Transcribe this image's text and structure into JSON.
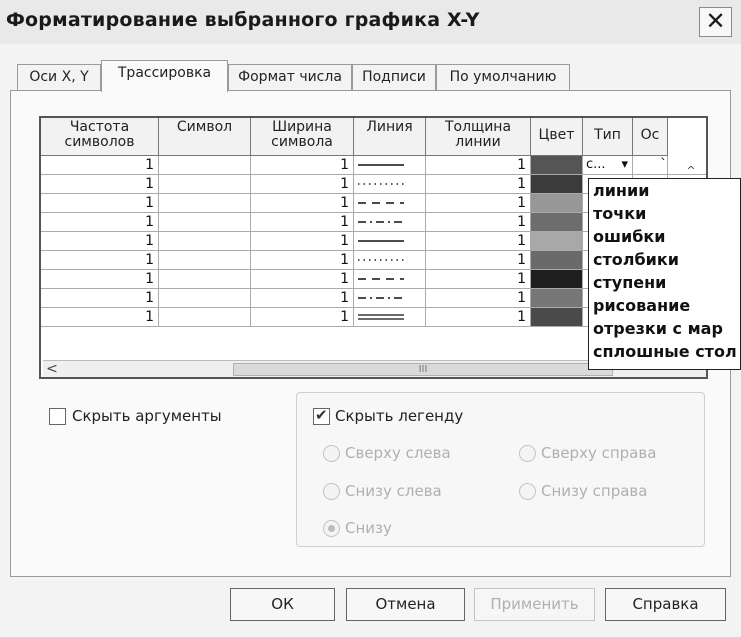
{
  "window": {
    "title": "Форматирование выбранного графика X-Y",
    "close_label": "✕"
  },
  "tabs": [
    "Оси X, Y",
    "Трассировка",
    "Формат числа",
    "Подписи",
    "По умолчанию"
  ],
  "grid": {
    "headers": [
      "Частота символов",
      "Символ",
      "Ширина символа",
      "Линия",
      "Толщина линии",
      "Цвет",
      "Тип",
      "Ос"
    ],
    "rows": [
      {
        "freq": "1",
        "width": "1",
        "line": "solid",
        "thickness": "1",
        "color": "#555555",
        "type": "с...",
        "type_arrow": "▾",
        "axis": "`"
      },
      {
        "freq": "1",
        "width": "1",
        "line": "dotted",
        "thickness": "1",
        "color": "#3b3b3b",
        "type": "",
        "type_arrow": "",
        "axis": ""
      },
      {
        "freq": "1",
        "width": "1",
        "line": "dashed",
        "thickness": "1",
        "color": "#979797",
        "type": "",
        "type_arrow": "",
        "axis": ""
      },
      {
        "freq": "1",
        "width": "1",
        "line": "dashdot",
        "thickness": "1",
        "color": "#6d6d6d",
        "type": "",
        "type_arrow": "",
        "axis": ""
      },
      {
        "freq": "1",
        "width": "1",
        "line": "solid",
        "thickness": "1",
        "color": "#a8a8a8",
        "type": "",
        "type_arrow": "",
        "axis": ""
      },
      {
        "freq": "1",
        "width": "1",
        "line": "dotted",
        "thickness": "1",
        "color": "#6a6a6a",
        "type": "",
        "type_arrow": "",
        "axis": ""
      },
      {
        "freq": "1",
        "width": "1",
        "line": "dashed",
        "thickness": "1",
        "color": "#1e1e1e",
        "type": "",
        "type_arrow": "",
        "axis": ""
      },
      {
        "freq": "1",
        "width": "1",
        "line": "dashdot",
        "thickness": "1",
        "color": "#777777",
        "type": "",
        "type_arrow": "",
        "axis": ""
      },
      {
        "freq": "1",
        "width": "1",
        "line": "double",
        "thickness": "1",
        "color": "#4a4a4a",
        "type": "",
        "type_arrow": "",
        "axis": ""
      }
    ],
    "hscroll_thumb_label": "III",
    "scroll_left": "<",
    "scroll_up": "^"
  },
  "type_dropdown": {
    "options": [
      "линии",
      "точки",
      "ошибки",
      "столбики",
      "ступени",
      "рисование",
      "отрезки с мар",
      "сплошные стол"
    ]
  },
  "hide_arguments": {
    "label": "Скрыть аргументы",
    "checked": false
  },
  "hide_legend": {
    "label": "Скрыть легенду",
    "checked": true,
    "check_mark": "✔"
  },
  "legend_position": {
    "options": [
      "Сверху слева",
      "Сверху справа",
      "Снизу слева",
      "Снизу справа",
      "Снизу"
    ],
    "selected": "Снизу",
    "enabled": false
  },
  "buttons": {
    "ok": "ОК",
    "cancel": "Отмена",
    "apply": "Применить",
    "help": "Справка"
  }
}
